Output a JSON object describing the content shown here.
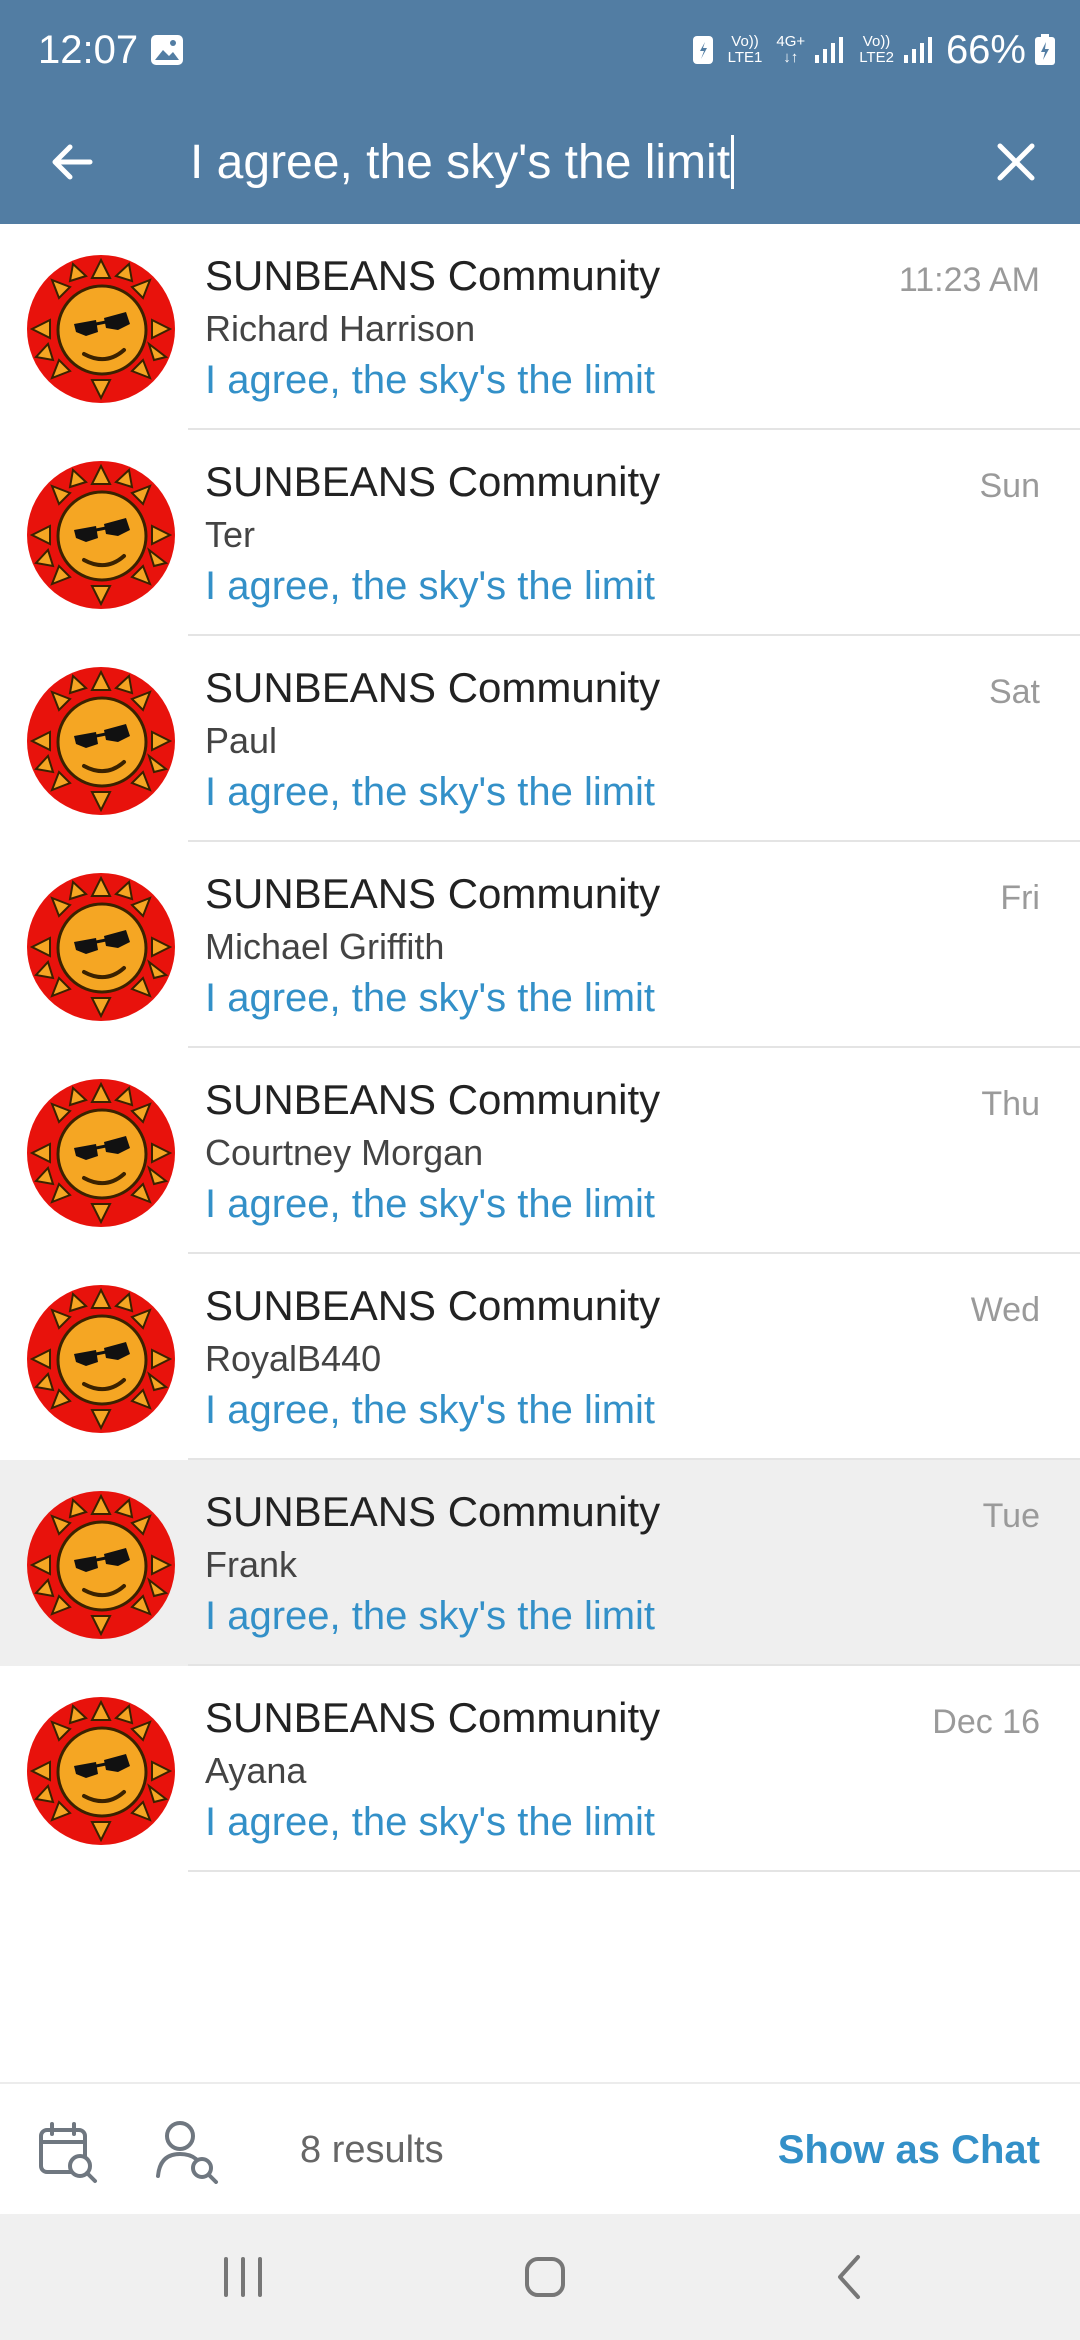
{
  "status_bar": {
    "time": "12:07",
    "net1_top": "Vo))",
    "net1_bottom": "LTE1",
    "net2_top": "4G+",
    "net2_bottom": "↓↑",
    "net3_top": "Vo))",
    "net3_bottom": "LTE2",
    "battery": "66%"
  },
  "search": {
    "query": "I agree, the sky's the limit"
  },
  "results": [
    {
      "chat": "SUNBEANS Community",
      "sender": "Richard Harrison",
      "message": "I agree, the sky's the limit",
      "date": "11:23 AM"
    },
    {
      "chat": "SUNBEANS Community",
      "sender": "Ter",
      "message": "I agree, the sky's the limit",
      "date": "Sun"
    },
    {
      "chat": "SUNBEANS Community",
      "sender": "Paul",
      "message": "I agree, the sky's the limit",
      "date": "Sat"
    },
    {
      "chat": "SUNBEANS Community",
      "sender": "Michael Griffith",
      "message": "I agree, the sky's the limit",
      "date": "Fri"
    },
    {
      "chat": "SUNBEANS Community",
      "sender": "Courtney Morgan",
      "message": "I agree, the sky's the limit",
      "date": "Thu"
    },
    {
      "chat": "SUNBEANS Community",
      "sender": "RoyalB440",
      "message": "I agree, the sky's the limit",
      "date": "Wed"
    },
    {
      "chat": "SUNBEANS Community",
      "sender": "Frank",
      "message": "I agree, the sky's the limit",
      "date": "Tue",
      "highlighted": true
    },
    {
      "chat": "SUNBEANS Community",
      "sender": "Ayana",
      "message": "I agree, the sky's the limit",
      "date": "Dec 16"
    }
  ],
  "bottom_bar": {
    "results_count": "8 results",
    "show_as_chat": "Show as Chat"
  },
  "icons": {
    "back": "arrow-left-icon",
    "clear": "close-icon",
    "calendar_search": "calendar-search-icon",
    "member_search": "person-search-icon",
    "nav_recents": "recents-icon",
    "nav_home": "home-icon",
    "nav_back": "chevron-left-icon"
  },
  "colors": {
    "header": "#527da3",
    "link": "#3390c8",
    "highlight_row": "#efefef"
  }
}
